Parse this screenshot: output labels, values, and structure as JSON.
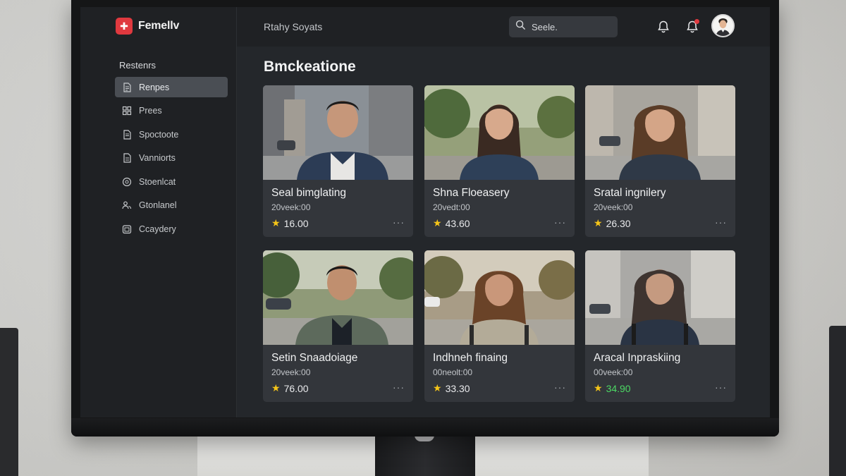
{
  "app": {
    "brand_name": "Femellv",
    "brand_logo_glyph": "✚",
    "accent_color": "#e0393f"
  },
  "sidebar": {
    "section_title": "Restenrs",
    "items": [
      {
        "label": "Renpes",
        "icon": "document-icon",
        "active": true
      },
      {
        "label": "Prees",
        "icon": "grid-icon",
        "active": false
      },
      {
        "label": "Spoctoote",
        "icon": "document-icon",
        "active": false
      },
      {
        "label": "Vanniorts",
        "icon": "document-icon",
        "active": false
      },
      {
        "label": "Stoenlcat",
        "icon": "circle-icon",
        "active": false
      },
      {
        "label": "Gtonlanel",
        "icon": "users-icon",
        "active": false
      },
      {
        "label": "Ccaydery",
        "icon": "calendar-icon",
        "active": false
      }
    ]
  },
  "topbar": {
    "title": "Rtahy Soyats",
    "search_placeholder": "Seele.",
    "notification_color": "#e0393f"
  },
  "main": {
    "title": "Bmckeatione",
    "cards": [
      {
        "name": "Seal bimglating",
        "meta": "20veek:00",
        "rating": "16.00",
        "rating_color": "#e8e9eb",
        "more": "···"
      },
      {
        "name": "Shna Floeasery",
        "meta": "20vedt:00",
        "rating": "43.60",
        "rating_color": "#e8e9eb",
        "more": "···"
      },
      {
        "name": "Sratal ingnilery",
        "meta": "20veek:00",
        "rating": "26.30",
        "rating_color": "#e8e9eb",
        "more": "···"
      },
      {
        "name": "Setin Snaadoiage",
        "meta": "20veek:00",
        "rating": "76.00",
        "rating_color": "#e8e9eb",
        "more": "···"
      },
      {
        "name": "Indhneh finaing",
        "meta": "00neolt:00",
        "rating": "33.30",
        "rating_color": "#e8e9eb",
        "more": "···"
      },
      {
        "name": "Aracal Inpraskiing",
        "meta": "00veek:00",
        "rating": "34.90",
        "rating_color": "#4cd964",
        "more": "···"
      }
    ]
  }
}
